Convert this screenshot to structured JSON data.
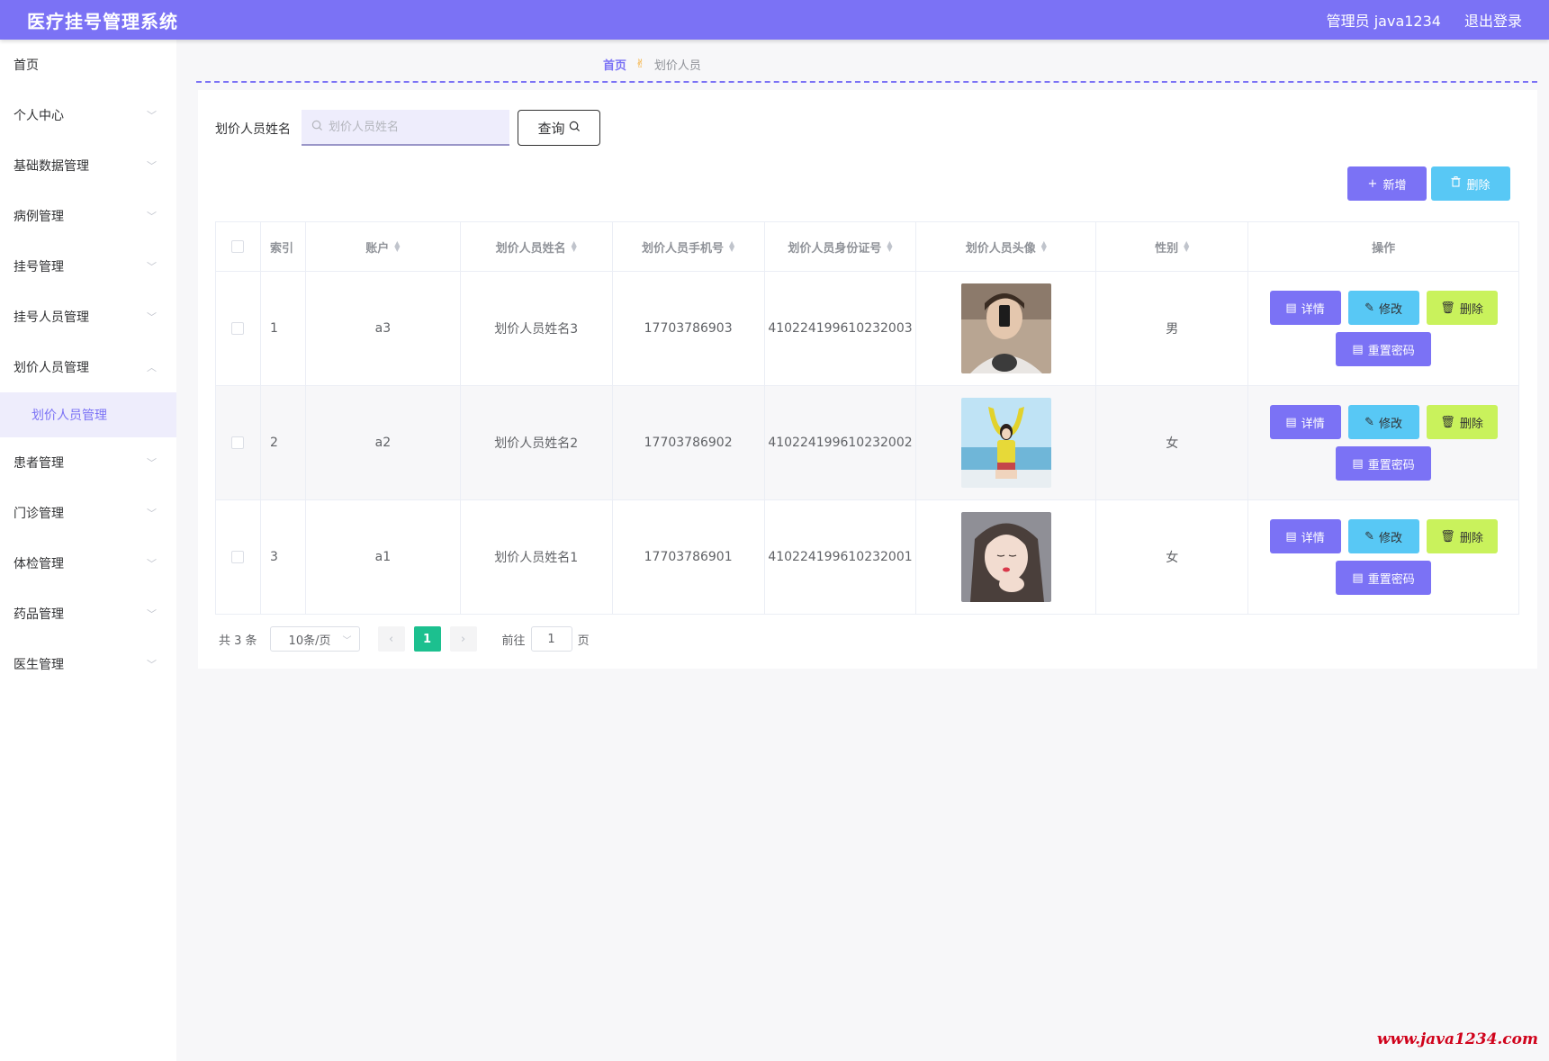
{
  "header": {
    "title": "医疗挂号管理系统",
    "user": "管理员 java1234",
    "logout": "退出登录",
    "color": "#7b72f5"
  },
  "sidebar": {
    "items": [
      {
        "label": "首页"
      },
      {
        "label": "个人中心"
      },
      {
        "label": "基础数据管理"
      },
      {
        "label": "病例管理"
      },
      {
        "label": "挂号管理"
      },
      {
        "label": "挂号人员管理"
      },
      {
        "label": "划价人员管理"
      },
      {
        "label": "患者管理"
      },
      {
        "label": "门诊管理"
      },
      {
        "label": "体检管理"
      },
      {
        "label": "药品管理"
      },
      {
        "label": "医生管理"
      }
    ],
    "active_sub": "划价人员管理"
  },
  "breadcrumb": {
    "home": "首页",
    "current": "划价人员"
  },
  "search": {
    "label": "划价人员姓名",
    "placeholder": "划价人员姓名",
    "query_label": "查询"
  },
  "toolbar": {
    "add_label": "新增",
    "delete_label": "删除"
  },
  "table": {
    "columns": [
      "索引",
      "账户",
      "划价人员姓名",
      "划价人员手机号",
      "划价人员身份证号",
      "划价人员头像",
      "性别",
      "操作"
    ],
    "rows": [
      {
        "index": "1",
        "account": "a3",
        "name": "划价人员姓名3",
        "phone": "17703786903",
        "id_number": "410224199610232003",
        "gender": "男"
      },
      {
        "index": "2",
        "account": "a2",
        "name": "划价人员姓名2",
        "phone": "17703786902",
        "id_number": "410224199610232002",
        "gender": "女"
      },
      {
        "index": "3",
        "account": "a1",
        "name": "划价人员姓名1",
        "phone": "17703786901",
        "id_number": "410224199610232001",
        "gender": "女"
      }
    ],
    "ops": {
      "detail": "详情",
      "edit": "修改",
      "delete": "删除",
      "reset": "重置密码"
    }
  },
  "pagination": {
    "total": "共 3 条",
    "page_size": "10条/页",
    "current_page": "1",
    "goto_label": "前往",
    "goto_value": "1",
    "page_suffix": "页"
  },
  "watermark": "www.java1234.com"
}
